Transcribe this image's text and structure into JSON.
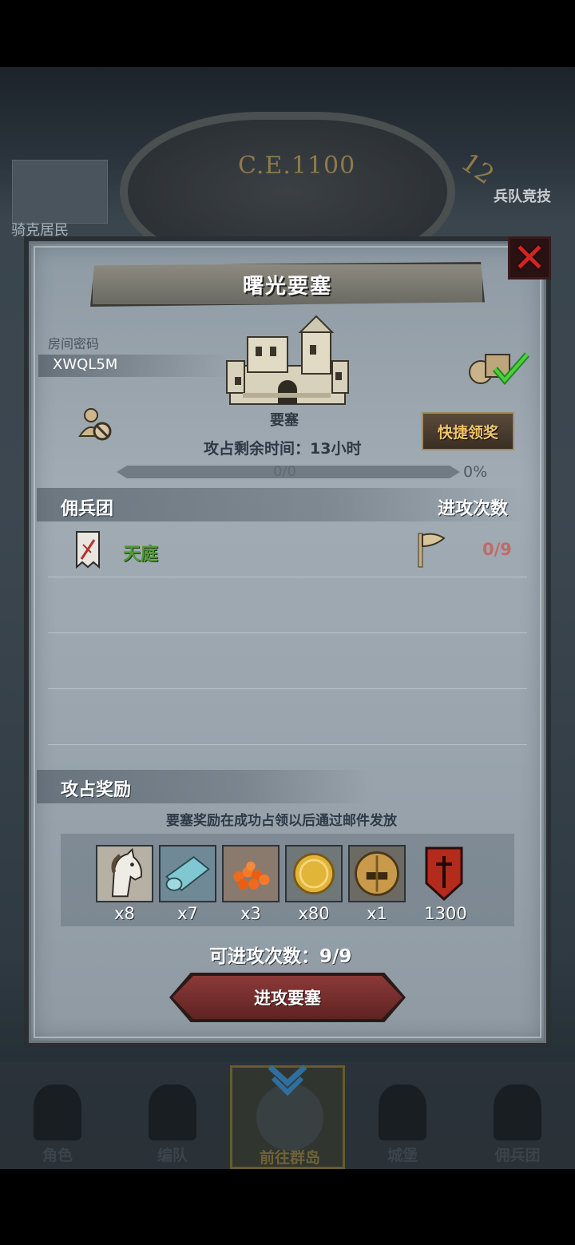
{
  "background": {
    "dial_text": "C.E.1100",
    "dial_number": "12",
    "left_label": "骑克居民",
    "right_label": "兵队竞技"
  },
  "modal": {
    "title": "曙光要塞",
    "room_label": "房间密码",
    "room_code": "XWQL5M",
    "fortress_name": "要塞",
    "quick_claim_label": "快捷领奖",
    "timer_text": "攻占剩余时间：13小时",
    "progress": {
      "text": "0/0",
      "percent_text": "0%",
      "fraction": 0
    },
    "mercenary_section": {
      "title": "佣兵团",
      "right_title": "进攻次数",
      "rows": [
        {
          "name": "天庭",
          "count": "0/9"
        }
      ]
    },
    "reward_section": {
      "title": "攻占奖励",
      "note": "要塞奖励在成功占领以后通过邮件发放",
      "items": [
        {
          "icon": "horse-icon",
          "qty": "x8"
        },
        {
          "icon": "cloth-icon",
          "qty": "x7"
        },
        {
          "icon": "orange-eggs-icon",
          "qty": "x3"
        },
        {
          "icon": "gold-coin-icon",
          "qty": "x80"
        },
        {
          "icon": "knight-helmet-icon",
          "qty": "x1"
        },
        {
          "icon": "red-banner-icon",
          "qty": "1300"
        }
      ]
    },
    "attempts_text": "可进攻次数：9/9",
    "attack_button_label": "进攻要塞"
  },
  "bottom_nav": {
    "items": [
      {
        "label": "角色"
      },
      {
        "label": "编队"
      },
      {
        "label": "前往群岛"
      },
      {
        "label": "城堡"
      },
      {
        "label": "佣兵团"
      }
    ],
    "active_index": 2
  },
  "colors": {
    "close_red": "#d62222",
    "guild_green": "#4f9b35",
    "attack_count_red": "#c06a6a",
    "quick_btn_gold": "#f1c56a",
    "attack_btn_red": "#8b3a38"
  }
}
